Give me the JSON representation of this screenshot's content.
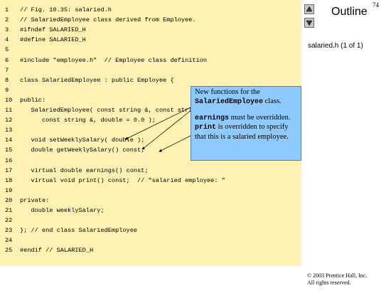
{
  "page_number": "74",
  "outline_title": "Outline",
  "file_label": "salaried.h (1 of 1)",
  "nav": {
    "up_icon": "triangle-up-icon",
    "down_icon": "triangle-down-icon"
  },
  "code_lines": [
    {
      "num": "1",
      "text": "// Fig. 10.35: salaried.h"
    },
    {
      "num": "2",
      "text": "// SalariedEmployee class derived from Employee."
    },
    {
      "num": "3",
      "text": "#ifndef SALARIED_H"
    },
    {
      "num": "4",
      "text": "#define SALARIED_H"
    },
    {
      "num": "5",
      "text": ""
    },
    {
      "num": "6",
      "text": "#include \"employee.h\"  // Employee class definition"
    },
    {
      "num": "7",
      "text": ""
    },
    {
      "num": "8",
      "text": "class SalariedEmployee : public Employee {"
    },
    {
      "num": "9",
      "text": ""
    },
    {
      "num": "10",
      "text": "public:"
    },
    {
      "num": "11",
      "text": "   SalariedEmployee( const string &, const string &,"
    },
    {
      "num": "12",
      "text": "      const string &, double = 0.0 );"
    },
    {
      "num": "13",
      "text": ""
    },
    {
      "num": "14",
      "text": "   void setWeeklySalary( double );"
    },
    {
      "num": "15",
      "text": "   double getWeeklySalary() const;"
    },
    {
      "num": "16",
      "text": ""
    },
    {
      "num": "17",
      "text": "   virtual double earnings() const;"
    },
    {
      "num": "18",
      "text": "   virtual void print() const;  // \"salaried employee: \""
    },
    {
      "num": "19",
      "text": ""
    },
    {
      "num": "20",
      "text": "private:"
    },
    {
      "num": "21",
      "text": "   double weeklySalary;"
    },
    {
      "num": "22",
      "text": ""
    },
    {
      "num": "23",
      "text": "}; // end class SalariedEmployee"
    },
    {
      "num": "24",
      "text": ""
    },
    {
      "num": "25",
      "text": "#endif // SALARIED_H"
    }
  ],
  "callout": {
    "line1_pre": "New functions for the",
    "line1_code": "SalariedEmployee",
    "line1_post": "class.",
    "p2_code1": "earnings",
    "p2_mid": "must be overridden.",
    "p2_code2": "print",
    "p2_post": "is overridden to specify that this is a salaried employee."
  },
  "copyright": {
    "line1": "© 2003 Prentice Hall, Inc.",
    "line2": "All rights reserved."
  },
  "colors": {
    "code_background": "#fff0b3",
    "callout_background": "#8fcaff",
    "callout_border": "#4a7fb8"
  }
}
